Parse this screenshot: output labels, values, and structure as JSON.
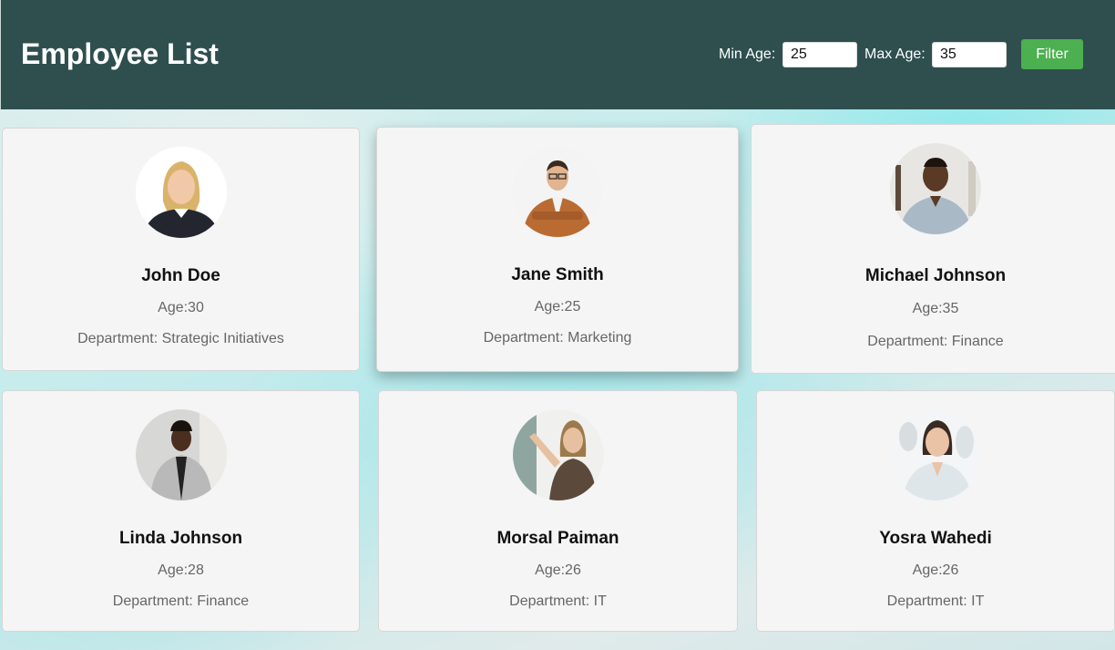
{
  "header": {
    "title": "Employee List",
    "min_age_label": "Min Age:",
    "min_age_value": "25",
    "max_age_label": "Max Age:",
    "max_age_value": "35",
    "filter_label": "Filter"
  },
  "colors": {
    "header_bg": "#2f4f4f",
    "filter_button": "#4caf50",
    "card_bg": "#f5f5f5"
  },
  "employees": [
    {
      "name": "John Doe",
      "age": "Age:30",
      "department": "Department: Strategic Initiatives",
      "photo_icon": "employee-photo"
    },
    {
      "name": "Jane Smith",
      "age": "Age:25",
      "department": "Department: Marketing",
      "photo_icon": "employee-photo"
    },
    {
      "name": "Michael Johnson",
      "age": "Age:35",
      "department": "Department: Finance",
      "photo_icon": "employee-photo"
    },
    {
      "name": "Linda Johnson",
      "age": "Age:28",
      "department": "Department: Finance",
      "photo_icon": "employee-photo"
    },
    {
      "name": "Morsal Paiman",
      "age": "Age:26",
      "department": "Department: IT",
      "photo_icon": "employee-photo"
    },
    {
      "name": "Yosra Wahedi",
      "age": "Age:26",
      "department": "Department: IT",
      "photo_icon": "employee-photo"
    }
  ]
}
